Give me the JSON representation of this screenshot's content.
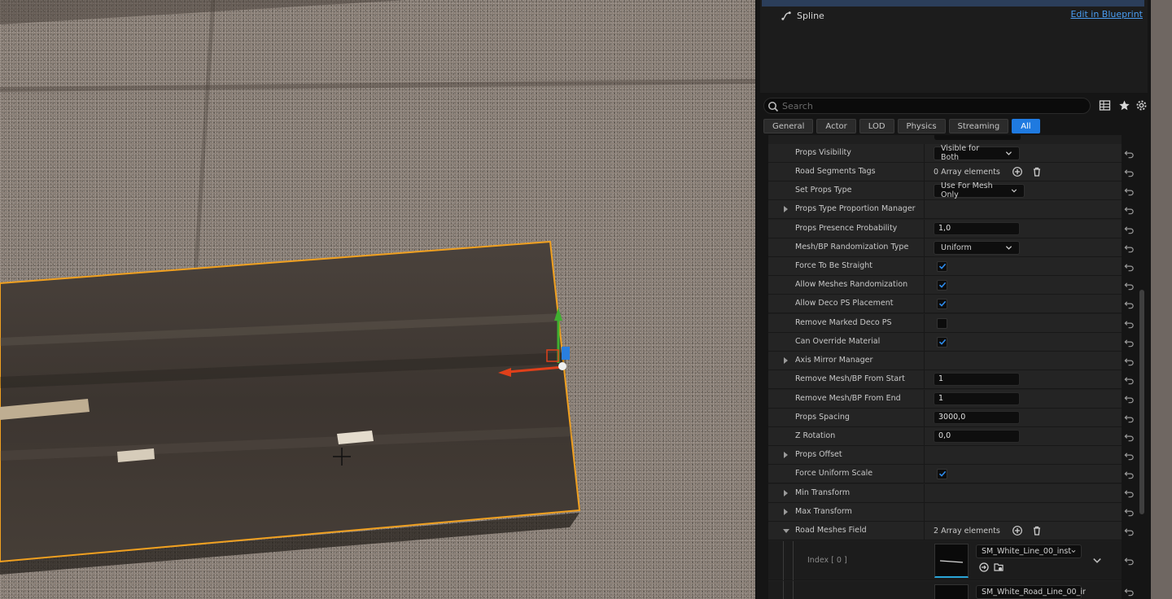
{
  "component_tree": {
    "spline_label": "Spline",
    "edit_blueprint": "Edit in Blueprint"
  },
  "search": {
    "placeholder": "Search"
  },
  "filter_tabs": [
    "General",
    "Actor",
    "LOD",
    "Physics",
    "Streaming",
    "All"
  ],
  "active_tab": "All",
  "properties": {
    "props_visibility": {
      "label": "Props Visibility",
      "value": "Visible for Both"
    },
    "road_segments_tags": {
      "label": "Road Segments Tags",
      "value": "0 Array elements"
    },
    "set_props_type": {
      "label": "Set Props Type",
      "value": "Use For Mesh Only"
    },
    "props_type_proportion_manager": {
      "label": "Props Type Proportion Manager"
    },
    "props_presence_probability": {
      "label": "Props Presence Probability",
      "value": "1,0"
    },
    "mesh_bp_randomization_type": {
      "label": "Mesh/BP Randomization Type",
      "value": "Uniform"
    },
    "force_to_be_straight": {
      "label": "Force To Be Straight",
      "checked": true
    },
    "allow_meshes_randomization": {
      "label": "Allow Meshes Randomization",
      "checked": true
    },
    "allow_deco_ps_placement": {
      "label": "Allow Deco PS Placement",
      "checked": true
    },
    "remove_marked_deco_ps": {
      "label": "Remove Marked Deco PS",
      "checked": false
    },
    "can_override_material": {
      "label": "Can Override Material",
      "checked": true
    },
    "axis_mirror_manager": {
      "label": "Axis Mirror Manager"
    },
    "remove_mesh_bp_from_start": {
      "label": "Remove Mesh/BP From Start",
      "value": "1"
    },
    "remove_mesh_bp_from_end": {
      "label": "Remove Mesh/BP From End",
      "value": "1"
    },
    "props_spacing": {
      "label": "Props Spacing",
      "value": "3000,0"
    },
    "z_rotation": {
      "label": "Z Rotation",
      "value": "0,0"
    },
    "props_offset": {
      "label": "Props Offset"
    },
    "force_uniform_scale": {
      "label": "Force Uniform Scale",
      "checked": true
    },
    "min_transform": {
      "label": "Min Transform"
    },
    "max_transform": {
      "label": "Max Transform"
    },
    "road_meshes_field": {
      "label": "Road Meshes Field",
      "value": "2 Array elements"
    }
  },
  "road_meshes": [
    {
      "index_label": "Index [ 0 ]",
      "asset": "SM_White_Line_00_inst"
    },
    {
      "index_label": "",
      "asset": "SM_White_Road_Line_00_ir"
    }
  ],
  "colors": {
    "accent": "#1f7ae0",
    "link": "#4a9df2",
    "selection_outline": "#f0a020",
    "gizmo_x": "#e0401a",
    "gizmo_y": "#40b030",
    "gizmo_z": "#2a7fe0"
  }
}
